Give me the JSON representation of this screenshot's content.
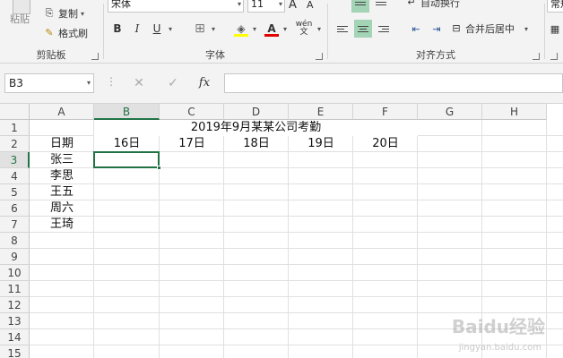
{
  "ribbon": {
    "clipboard": {
      "paste_label": "粘贴",
      "copy_label": "复制",
      "format_painter_label": "格式刷",
      "group_label": "剪贴板"
    },
    "font": {
      "font_name": "宋体",
      "font_size": "11",
      "bold": "B",
      "italic": "I",
      "underline": "U",
      "group_label": "字体"
    },
    "alignment": {
      "wrap_text_label": "自动换行",
      "merge_center_label": "合并后居中",
      "group_label": "对齐方式"
    },
    "number": {
      "format_label": "常规"
    }
  },
  "formula_bar": {
    "name_box": "B3",
    "cancel": "✕",
    "enter": "✓",
    "fx": "fx",
    "formula": ""
  },
  "sheet": {
    "columns": [
      "A",
      "B",
      "C",
      "D",
      "E",
      "F",
      "G",
      "H"
    ],
    "rows": [
      "1",
      "2",
      "3",
      "4",
      "5",
      "6",
      "7",
      "8",
      "9",
      "10",
      "11",
      "12",
      "13",
      "14",
      "15"
    ],
    "selected_cell": "B3",
    "title": "2019年9月某某公司考勤",
    "header_row": [
      "日期",
      "16日",
      "17日",
      "18日",
      "19日",
      "20日"
    ],
    "names": [
      "张三",
      "李思",
      "王五",
      "周六",
      "王琦"
    ]
  },
  "watermark": {
    "main": "Baidu经验",
    "sub": "jingyan.baidu.com"
  }
}
